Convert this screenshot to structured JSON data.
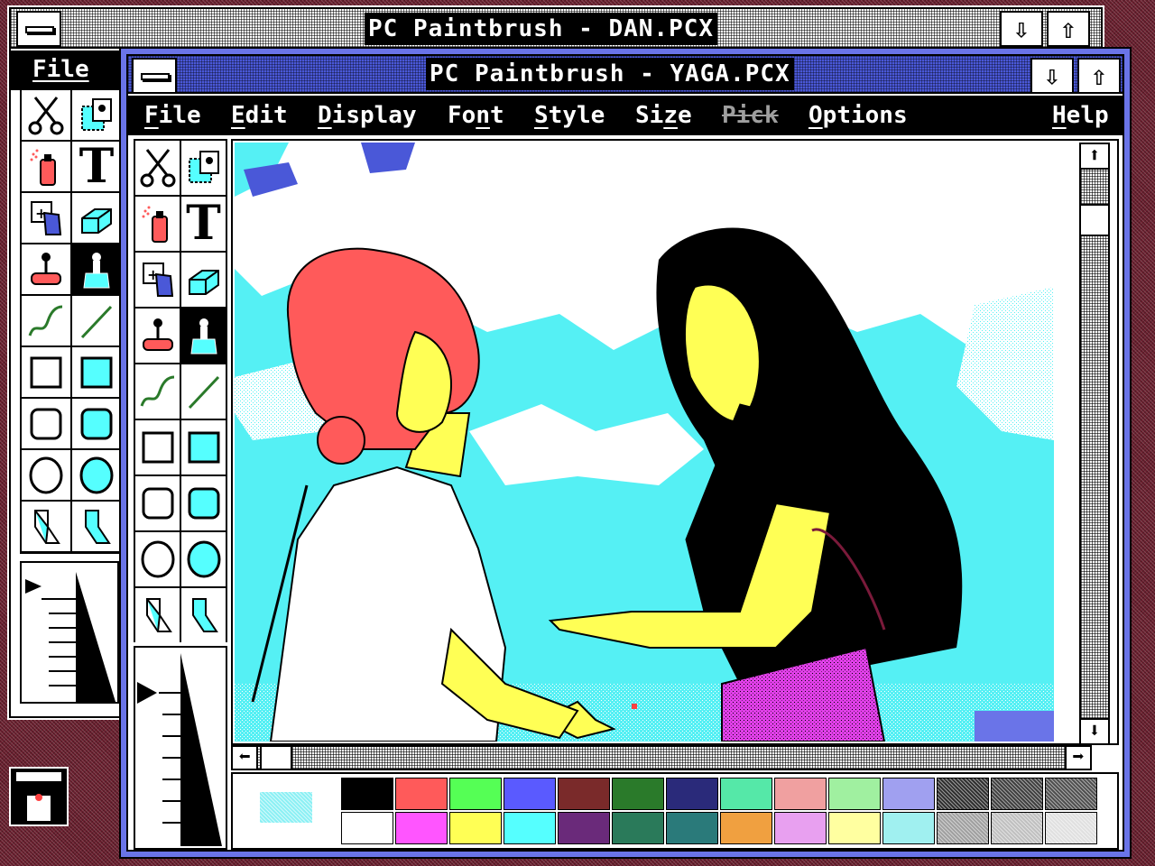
{
  "back_window": {
    "title": "PC Paintbrush - DAN.PCX",
    "menu_file": "File",
    "btn_down": "⇩",
    "btn_up": "⇧"
  },
  "front_window": {
    "title": "PC Paintbrush - YAGA.PCX",
    "btn_down": "⇩",
    "btn_up": "⇧",
    "menu": [
      {
        "label": "File",
        "enabled": true
      },
      {
        "label": "Edit",
        "enabled": true
      },
      {
        "label": "Display",
        "enabled": true
      },
      {
        "label": "Font",
        "enabled": true
      },
      {
        "label": "Style",
        "enabled": true
      },
      {
        "label": "Size",
        "enabled": true
      },
      {
        "label": "Pick",
        "enabled": false
      },
      {
        "label": "Options",
        "enabled": true
      },
      {
        "label": "Help",
        "enabled": true
      }
    ],
    "scroll": {
      "up": "⬆",
      "down": "⬇",
      "left": "⬅",
      "right": "➡"
    }
  },
  "tools": [
    {
      "name": "scissors-tool",
      "icon": "scissors-icon"
    },
    {
      "name": "pick-tool",
      "icon": "pick-icon"
    },
    {
      "name": "airbrush-tool",
      "icon": "airbrush-icon"
    },
    {
      "name": "text-tool",
      "icon": "text-icon",
      "glyph": "T"
    },
    {
      "name": "color-eraser-tool",
      "icon": "color-eraser-icon"
    },
    {
      "name": "eraser-tool",
      "icon": "eraser-icon"
    },
    {
      "name": "paint-roller-tool",
      "icon": "paint-roller-icon"
    },
    {
      "name": "brush-tool",
      "icon": "brush-icon",
      "selected": true
    },
    {
      "name": "curve-tool",
      "icon": "curve-icon"
    },
    {
      "name": "line-tool",
      "icon": "line-icon"
    },
    {
      "name": "box-tool",
      "icon": "box-icon"
    },
    {
      "name": "filled-box-tool",
      "icon": "filled-box-icon"
    },
    {
      "name": "rounded-box-tool",
      "icon": "rounded-box-icon"
    },
    {
      "name": "filled-rounded-box-tool",
      "icon": "filled-rounded-box-icon"
    },
    {
      "name": "circle-tool",
      "icon": "circle-icon"
    },
    {
      "name": "filled-circle-tool",
      "icon": "filled-circle-icon"
    },
    {
      "name": "polygon-tool",
      "icon": "polygon-icon"
    },
    {
      "name": "filled-polygon-tool",
      "icon": "filled-polygon-icon"
    }
  ],
  "palette": {
    "current_foreground": "#8cf0f4",
    "colors": [
      "#000000",
      "#ffffff",
      "#ff5a5a",
      "#ff55ff",
      "#55ff55",
      "#ffff55",
      "#5a5aff",
      "#55ffff",
      "#7a2a2a",
      "#6a2a7a",
      "#2a7a2a",
      "#2a7a5a",
      "#2a2a7a",
      "#2a7a7a",
      "#55e8a8",
      "#f0a040",
      "#f0a0a0",
      "#e8a0f0",
      "#a0f0a0",
      "#ffffa0",
      "#a0a0f0",
      "#a0f0f0",
      "#303030",
      "#a0a0a0",
      "#404040",
      "#c0c0c0",
      "#505050",
      "#e0e0e0"
    ]
  },
  "accent": {
    "desktop": "#6a1f2e",
    "front_frame": "#6a74e8",
    "sky": "#55f0f4"
  }
}
